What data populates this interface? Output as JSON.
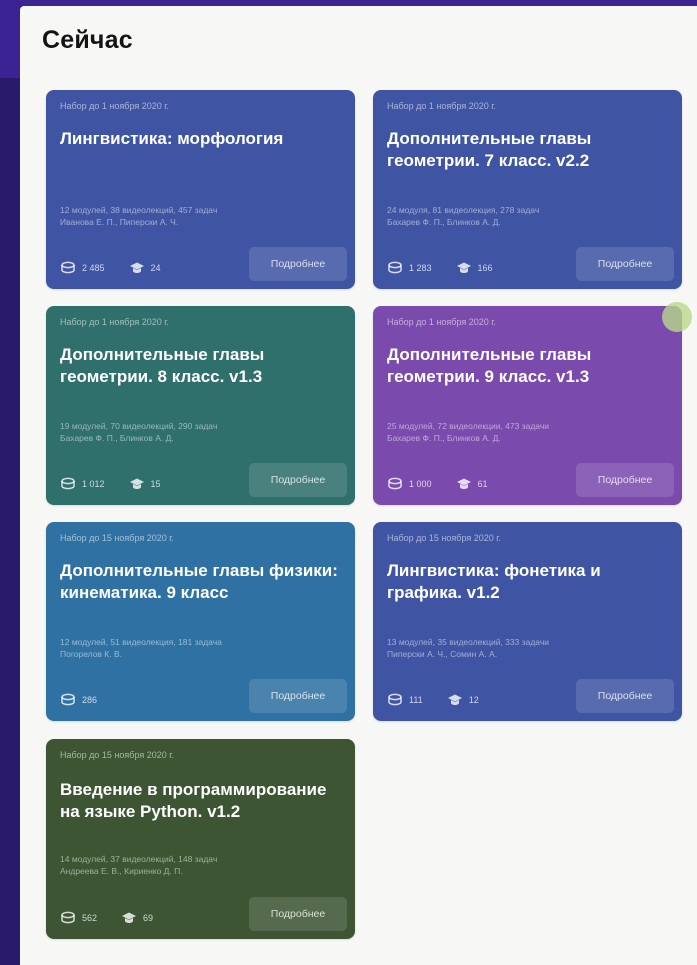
{
  "heading": "Сейчас",
  "more_label": "Подробнее",
  "cards": [
    {
      "deadline": "Набор до 1 ноября 2020 г.",
      "title": "Лингвистика: морфология",
      "meta1": "12 модулей, 38 видеолекций, 457 задач",
      "meta2": "Иванова Е. П., Пиперски А. Ч.",
      "students": "2 485",
      "graduates": "24",
      "color": "#3f55a3"
    },
    {
      "deadline": "Набор до 1 ноября 2020 г.",
      "title": "Дополнительные главы геометрии. 7 класс. v2.2",
      "meta1": "24 модуля, 81 видеолекция, 278 задач",
      "meta2": "Бахарев Ф. П., Блинков А. Д.",
      "students": "1 283",
      "graduates": "166",
      "color": "#3f55a3"
    },
    {
      "deadline": "Набор до 1 ноября 2020 г.",
      "title": "Дополнительные главы геометрии. 8 класс. v1.3",
      "meta1": "19 модулей, 70 видеолекций, 290 задач",
      "meta2": "Бахарев Ф. П., Блинков А. Д.",
      "students": "1 012",
      "graduates": "15",
      "color": "#2f6f6c"
    },
    {
      "deadline": "Набор до 1 ноября 2020 г.",
      "title": "Дополнительные главы геометрии. 9 класс. v1.3",
      "meta1": "25 модулей, 72 видеолекции, 473 задачи",
      "meta2": "Бахарев Ф. П., Блинков А. Д.",
      "students": "1 000",
      "graduates": "61",
      "color": "#7a4bad"
    },
    {
      "deadline": "Набор до 15 ноября 2020 г.",
      "title": "Дополнительные главы физики: кинематика. 9 класс",
      "meta1": "12 модулей, 51 видеолекция, 181 задача",
      "meta2": "Погорелов К. В.",
      "students": "286",
      "graduates": "",
      "color": "#2f71a2"
    },
    {
      "deadline": "Набор до 15 ноября 2020 г.",
      "title": "Лингвистика: фонетика и графика. v1.2",
      "meta1": "13 модулей, 35 видеолекций, 333 задачи",
      "meta2": "Пиперски А. Ч., Сомин А. А.",
      "students": "111",
      "graduates": "12",
      "color": "#3f55a3"
    },
    {
      "deadline": "Набор до 15 ноября 2020 г.",
      "title": "Введение в программирование на языке Python. v1.2",
      "meta1": "14 модулей, 37 видеолекций, 148 задач",
      "meta2": "Андреева Е. В., Кириенко Д. П.",
      "students": "562",
      "graduates": "69",
      "color": "#3d5533"
    }
  ],
  "icons": {
    "students": "students-icon",
    "graduates": "graduation-cap-icon"
  }
}
